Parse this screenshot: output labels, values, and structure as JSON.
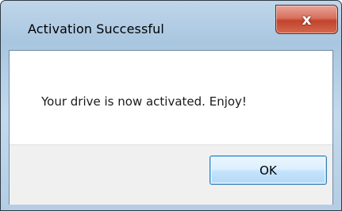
{
  "dialog": {
    "title": "Activation Successful",
    "message": "Your drive is now activated. Enjoy!",
    "ok_label": "OK",
    "close_icon": "close-icon",
    "close_glyph": "x"
  },
  "colors": {
    "title_bar": "#b4cde4",
    "close_button": "#c3432c",
    "button_area": "#f0f0f0",
    "ok_border": "#3c7fb1"
  }
}
